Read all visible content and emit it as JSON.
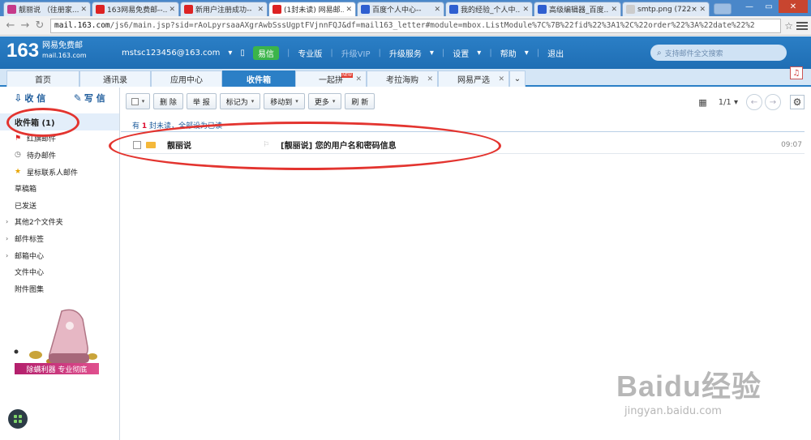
{
  "browser": {
    "tabs": [
      {
        "title": "靓丽说 （往册家...",
        "active": false,
        "fav_color": "#c63a8a"
      },
      {
        "title": "163网易免费邮--...",
        "active": false,
        "fav_color": "#d22"
      },
      {
        "title": "新用户注册成功--",
        "active": false,
        "fav_color": "#d22"
      },
      {
        "title": "(1封未读) 网易邮...",
        "active": true,
        "fav_color": "#d22"
      },
      {
        "title": "百度个人中心--",
        "active": false,
        "fav_color": "#2f5fd0"
      },
      {
        "title": "我的经验_个人中...",
        "active": false,
        "fav_color": "#2f5fd0"
      },
      {
        "title": "高级编辑器_百度...",
        "active": false,
        "fav_color": "#2f5fd0"
      },
      {
        "title": "smtp.png (722×",
        "active": false,
        "fav_color": "#cccccc"
      }
    ],
    "url_host": "mail.163.com",
    "url_path": "/js6/main.jsp?sid=rAoLpyrsaaAXgrAwbSssUgptFVjnnFQJ&df=mail163_letter#module=mbox.ListModule%7C%7B%22fid%22%3A1%2C%22order%22%3A%22date%22%2",
    "nav_back": "←",
    "nav_forward": "→",
    "star": "☆"
  },
  "header": {
    "logo_num": "163",
    "logo_text": "网易免费邮",
    "logo_domain": "mail.163.com",
    "account": "mstsc123456@163.com",
    "yixin": "易信",
    "links": [
      "专业版",
      "升级VIP",
      "升级服务",
      "设置",
      "帮助",
      "退出"
    ],
    "search_placeholder": "支持邮件全文搜索"
  },
  "nav": {
    "tabs": [
      {
        "label": "首页"
      },
      {
        "label": "通讯录"
      },
      {
        "label": "应用中心"
      },
      {
        "label": "收件箱"
      },
      {
        "label": "一起拼"
      },
      {
        "label": "考拉海购"
      },
      {
        "label": "网易严选"
      }
    ],
    "new_badge": "NEW"
  },
  "sidebar": {
    "receive": "收 信",
    "write": "写 信",
    "items": [
      {
        "label": "收件箱 (1)"
      },
      {
        "label": "红旗邮件"
      },
      {
        "label": "待办邮件"
      },
      {
        "label": "星标联系人邮件"
      },
      {
        "label": "草稿箱"
      },
      {
        "label": "已发送"
      },
      {
        "label": "其他2个文件夹"
      },
      {
        "label": "邮件标签"
      },
      {
        "label": "邮箱中心"
      },
      {
        "label": "文件中心"
      },
      {
        "label": "附件图集"
      }
    ],
    "ad_text": "除螨利器  专业彻底"
  },
  "toolbar": {
    "delete": "删 除",
    "report": "举 报",
    "mark_as": "标记为",
    "move_to": "移动到",
    "more": "更多",
    "refresh": "刷 新",
    "page": "1/1"
  },
  "list": {
    "unread_prefix": "有",
    "unread_count": "1",
    "unread_suffix": "封未读，",
    "unread_action": "全部设为已读",
    "messages": [
      {
        "from": "靓丽说",
        "subject": "[靓丽说] 您的用户名和密码信息",
        "time": "09:07"
      }
    ]
  },
  "watermark": {
    "line1": "Baidu经验",
    "line2": "jingyan.baidu.com"
  },
  "colors": {
    "accent": "#2b7fc6",
    "annotation": "#e3342f",
    "envelope": "#f4b83a"
  }
}
